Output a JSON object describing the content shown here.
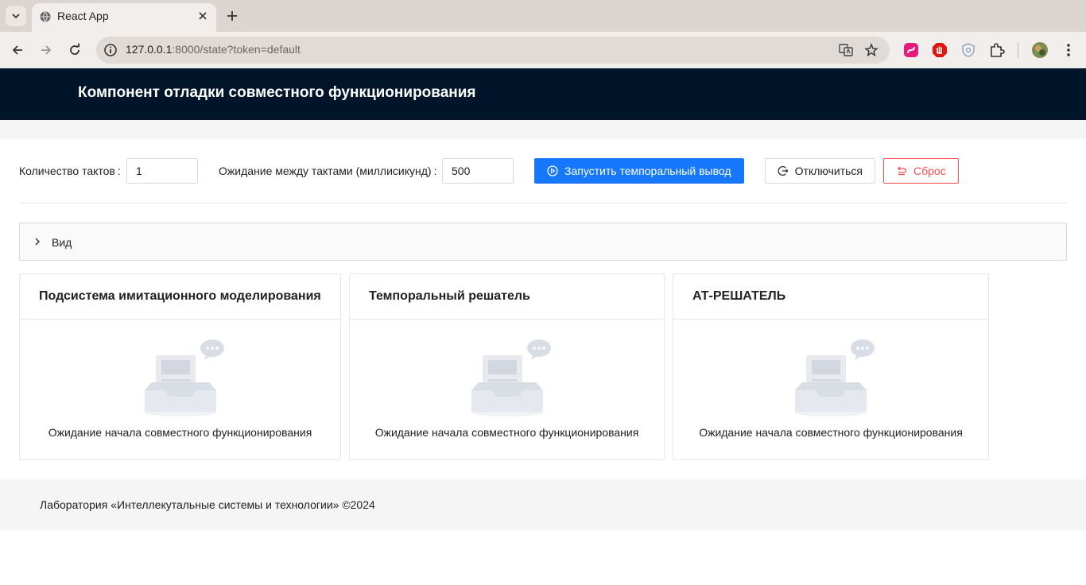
{
  "browser": {
    "tab_title": "React App",
    "url_host": "127.0.0.1",
    "url_rest": ":8000/state?token=default"
  },
  "app": {
    "title": "Компонент отладки совместного функционирования"
  },
  "controls": {
    "ticks_label": "Количество тактов",
    "ticks_value": "1",
    "wait_label": "Ожидание между тактами (миллисикунд)",
    "wait_value": "500",
    "run_label": "Запустить темпоральный вывод",
    "disconnect_label": "Отключиться",
    "reset_label": "Сброс"
  },
  "view_panel": {
    "label": "Вид"
  },
  "cards": [
    {
      "title": "Подсистема имитационного моделирования",
      "empty_text": "Ожидание начала совместного функционирования"
    },
    {
      "title": "Темпоральный решатель",
      "empty_text": "Ожидание начала совместного функционирования"
    },
    {
      "title": "АТ-РЕШАТЕЛЬ",
      "empty_text": "Ожидание начала совместного функционирования"
    }
  ],
  "footer": {
    "text": "Лаборатория «Интеллекутальные системы и технологии» ©2024"
  },
  "colors": {
    "header_bg": "#001529",
    "primary": "#1677ff",
    "danger": "#ff4d4f"
  }
}
